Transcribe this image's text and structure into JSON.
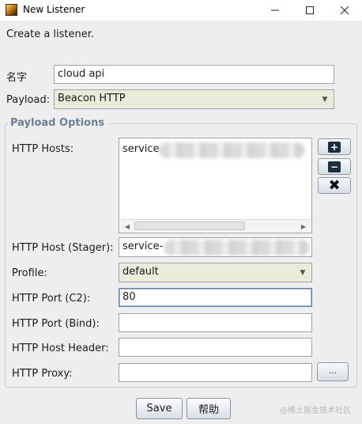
{
  "window": {
    "title": "New Listener",
    "icon": "app-icon",
    "controls": [
      "minimize-icon",
      "maximize-icon",
      "close-icon"
    ]
  },
  "header": {
    "description": "Create a listener."
  },
  "form": {
    "name_label": "名字",
    "name_value": "cloud api",
    "payload_label": "Payload:",
    "payload_value": "Beacon HTTP"
  },
  "payload_options": {
    "title": "Payload Options",
    "hosts_label": "HTTP Hosts:",
    "hosts": [
      "service"
    ],
    "host_buttons": [
      "plus-icon",
      "minus-icon",
      "x-icon"
    ],
    "stager_label": "HTTP Host (Stager):",
    "stager_value": "service-",
    "profile_label": "Profile:",
    "profile_value": "default",
    "port_c2_label": "HTTP Port (C2):",
    "port_c2_value": "80",
    "port_bind_label": "HTTP Port (Bind):",
    "port_bind_value": "",
    "host_header_label": "HTTP Host Header:",
    "host_header_value": "",
    "proxy_label": "HTTP Proxy:",
    "proxy_value": "",
    "proxy_button_label": "..."
  },
  "footer": {
    "save_label": "Save",
    "help_label": "帮助",
    "watermark": "@稀土掘金技术社区"
  }
}
